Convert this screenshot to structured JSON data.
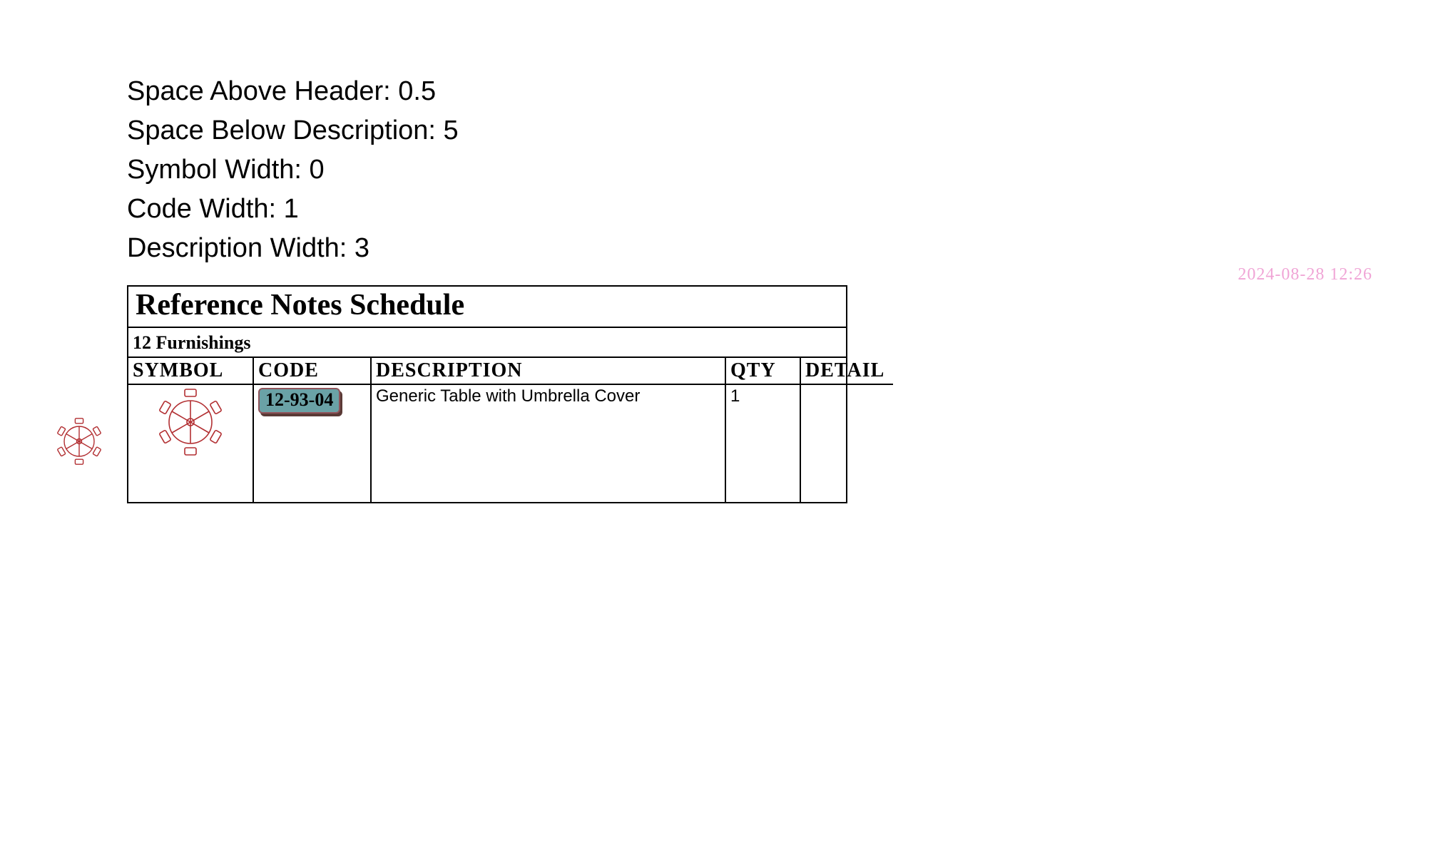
{
  "properties": {
    "space_above_header": "Space Above Header: 0.5",
    "space_below_description": "Space Below Description: 5",
    "symbol_width": "Symbol Width: 0",
    "code_width": "Code Width: 1",
    "description_width": "Description Width: 3"
  },
  "timestamp": "2024-08-28 12:26",
  "schedule": {
    "title": "Reference Notes Schedule",
    "section": "12 Furnishings",
    "headers": {
      "symbol": "SYMBOL",
      "code": "CODE",
      "description": "DESCRIPTION",
      "qty": "QTY",
      "detail": "DETAIL"
    },
    "row": {
      "code": "12-93-04",
      "description": "Generic Table with Umbrella Cover",
      "qty": "1",
      "detail": ""
    }
  }
}
